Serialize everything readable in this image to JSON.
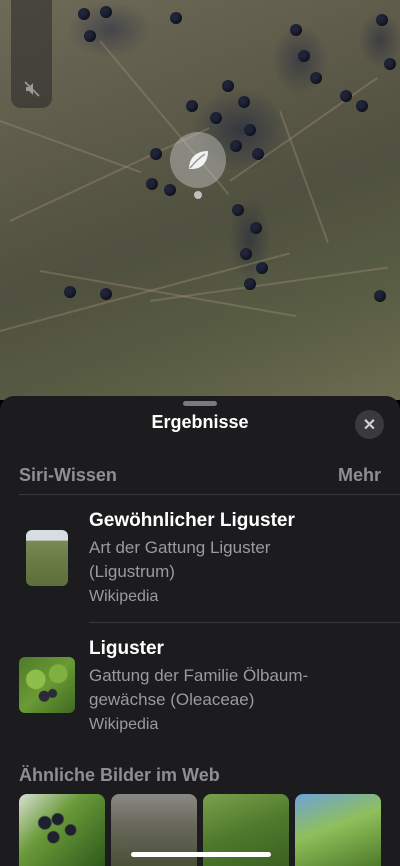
{
  "sheet": {
    "title": "Ergebnisse",
    "close_label": "✕"
  },
  "siri_knowledge": {
    "header": "Siri-Wissen",
    "more": "Mehr",
    "results": [
      {
        "title": "Gewöhnlicher Liguster",
        "subtitle_line1": "Art der Gattung Liguster",
        "subtitle_line2": "(Ligustrum)",
        "source": "Wikipedia"
      },
      {
        "title": "Liguster",
        "subtitle_line1": "Gattung der Familie Ölbaum-",
        "subtitle_line2": "gewächse (Oleaceae)",
        "source": "Wikipedia"
      }
    ]
  },
  "similar_images": {
    "header": "Ähnliche Bilder im Web"
  },
  "icons": {
    "mute": "speaker-muted-icon",
    "lookup": "leaf-icon",
    "close": "close-icon"
  },
  "colors": {
    "sheet_bg": "#1c1c1e",
    "secondary_text": "#9a9a9f"
  }
}
